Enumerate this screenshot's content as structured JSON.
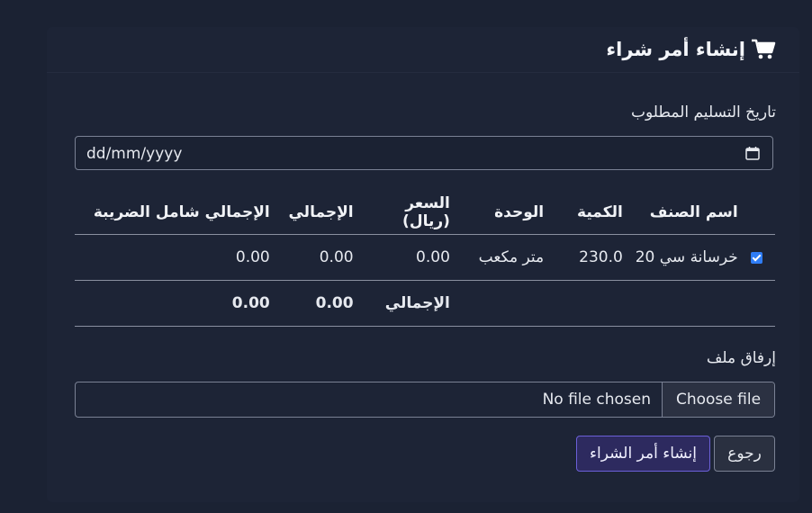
{
  "header": {
    "title": "إنشاء أمر شراء",
    "icon": "cart-icon"
  },
  "delivery": {
    "label": "تاريخ التسليم المطلوب",
    "placeholder": "dd/mm/yyyy"
  },
  "table": {
    "headers": {
      "name": "اسم الصنف",
      "qty": "الكمية",
      "unit": "الوحدة",
      "price": "السعر (ريال)",
      "total": "الإجمالي",
      "total_tax": "الإجمالي شامل الضريبة"
    },
    "rows": [
      {
        "checked": true,
        "name": "خرسانة سي 20",
        "qty": "230.0",
        "unit": "متر مكعب",
        "price": "0.00",
        "total": "0.00",
        "total_tax": "0.00"
      }
    ],
    "footer": {
      "label": "الإجمالي",
      "total": "0.00",
      "total_tax": "0.00"
    }
  },
  "attachment": {
    "label": "إرفاق ملف",
    "button": "Choose file",
    "status": "No file chosen"
  },
  "actions": {
    "back": "رجوع",
    "submit": "إنشاء أمر الشراء"
  },
  "colors": {
    "background": "#1b2233",
    "checkbox": "#2f7df6",
    "submit_border": "#6b60d8"
  }
}
